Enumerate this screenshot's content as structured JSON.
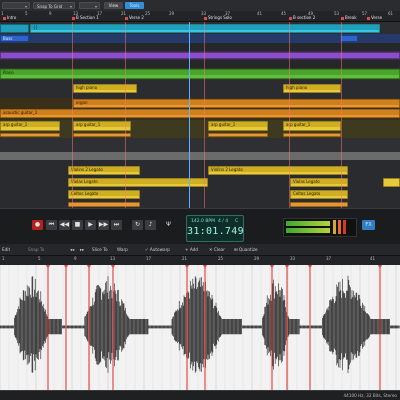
{
  "toolbar": {
    "snap_value": "",
    "snap_mode": "Snap To Grid",
    "mode_label": "",
    "view_label": "View",
    "tools_label": "Tools"
  },
  "ruler": {
    "numbers": [
      "1",
      "5",
      "9",
      "13",
      "17",
      "21",
      "25",
      "29",
      "33",
      "37",
      "41",
      "45",
      "49",
      "53",
      "57",
      "61"
    ],
    "markers": [
      "Intro",
      "B Section 1",
      "Verse 2",
      "Strings Solo",
      "B section 2",
      "Break",
      "Verse"
    ]
  },
  "clips": {
    "drums": "{}",
    "bass": "Bass",
    "piano": "Piano",
    "high_piano": "high piano",
    "organ": "organ",
    "acoustic_guitar": "acoustic guitar_1",
    "arp_guitar": "arp guitar_1",
    "violins": "Violins 2 Legato",
    "violas": "Violas Legato",
    "celtos": "Celtos Legato"
  },
  "transport": {
    "tempo": "142.0 BPM",
    "signature": "4 / 4",
    "key": "C",
    "time": "31:01.749",
    "fx_label": "FX"
  },
  "editor": {
    "edit_label": "Edit",
    "snap_label": "Snap To",
    "slice_label": "Slice To",
    "warp_label": "Warp",
    "autowarp_label": "Autowarp",
    "add_label": "Add",
    "clear_label": "Clear",
    "quantize_label": "Quantize",
    "ruler_numbers": [
      "1",
      "5",
      "9",
      "13",
      "17",
      "21",
      "25",
      "29",
      "33",
      "37",
      "41"
    ]
  },
  "status": {
    "format": "44100 Hz, 32 Bits, Stereo"
  },
  "colors": {
    "accent_blue": "#2f8fd8",
    "cyan": "#35c8e3",
    "blue": "#2e63c9",
    "purple": "#8a4fc7",
    "green": "#5fbf3c",
    "yellow": "#e8c93a",
    "orange": "#e8962f",
    "grey": "#7d7d7d",
    "marker_red": "#e34a4a",
    "waveform": "#1a1a1a",
    "lcd": "#9ff5e6"
  },
  "icons": [
    "rewind-icon",
    "back-icon",
    "stop-icon",
    "play-icon",
    "forward-icon",
    "end-icon",
    "loop-icon",
    "metronome-icon",
    "fx-icon",
    "record-icon"
  ]
}
